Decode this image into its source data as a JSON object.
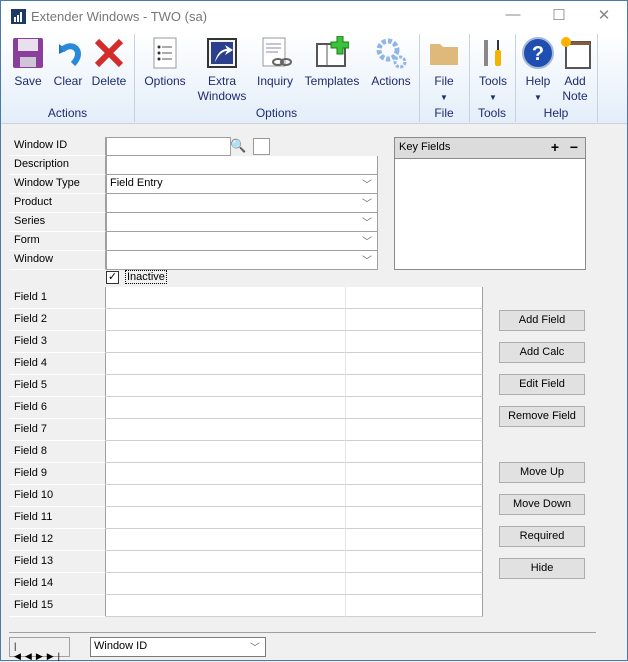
{
  "window": {
    "title": "Extender Windows  -  TWO (sa)",
    "minimize": "—",
    "maximize": "☐",
    "close": "✕"
  },
  "ribbon": {
    "buttons": [
      {
        "label": "Save",
        "icon": "save-icon"
      },
      {
        "label": "Clear",
        "icon": "undo-icon"
      },
      {
        "label": "Delete",
        "icon": "delete-icon"
      },
      {
        "label": "Options",
        "icon": "options-list-icon"
      },
      {
        "label": "Extra Windows",
        "icon": "extra-windows-icon"
      },
      {
        "label": "Inquiry",
        "icon": "inquiry-icon"
      },
      {
        "label": "Templates",
        "icon": "templates-icon"
      },
      {
        "label": "Actions",
        "icon": "gears-icon"
      },
      {
        "label": "File",
        "icon": "folder-icon"
      },
      {
        "label": "Tools",
        "icon": "tools-icon"
      },
      {
        "label": "Help",
        "icon": "help-icon"
      },
      {
        "label": "Add Note",
        "icon": "note-icon"
      }
    ],
    "groups": [
      "Actions",
      "Options",
      "File",
      "Tools",
      "Help"
    ],
    "dropdown_arrow": "▼"
  },
  "form": {
    "labels": [
      "Window ID",
      "Description",
      "Window Type",
      "Product",
      "Series",
      "Form",
      "Window"
    ],
    "values": [
      "",
      "",
      "Field Entry",
      "",
      "",
      "",
      ""
    ],
    "inactive_label": "Inactive",
    "inactive_checked": true,
    "fields": [
      "Field 1",
      "Field 2",
      "Field 3",
      "Field 4",
      "Field 5",
      "Field 6",
      "Field 7",
      "Field 8",
      "Field 9",
      "Field 10",
      "Field 11",
      "Field 12",
      "Field 13",
      "Field 14",
      "Field 15"
    ]
  },
  "key_fields": {
    "title": "Key Fields",
    "add": "+",
    "remove": "−"
  },
  "buttons": [
    "Add Field",
    "Add Calc",
    "Edit Field",
    "Remove Field",
    "Move Up",
    "Move Down",
    "Required",
    "Hide"
  ],
  "footer": {
    "sort_value": "Window ID",
    "nav": [
      "first",
      "previous",
      "next",
      "last"
    ]
  }
}
